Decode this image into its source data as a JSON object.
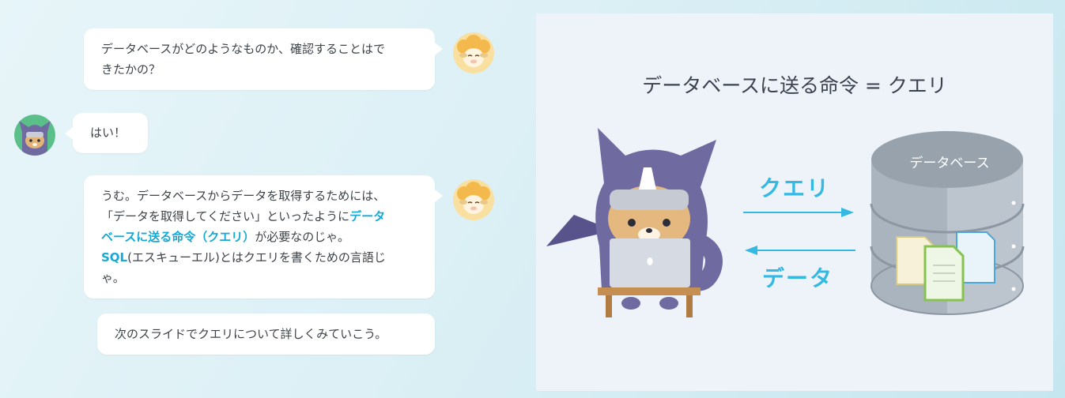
{
  "chat": {
    "msg1": {
      "line1": "データベースがどのようなものか、確認することはで",
      "line2": "きたかの？"
    },
    "msg2": {
      "text": "はい！"
    },
    "msg3": {
      "line1": "うむ。データベースからデータを取得するためには、",
      "line2_pre": "「データを取得してください」といったように",
      "line2_hl": "データ",
      "line3_hl": "ベースに送る命令（クエリ）",
      "line3_post": "が必要なのじゃ。",
      "line4_hl": "SQL",
      "line4_post": "(エスキューエル)とはクエリを書くための言語じ",
      "line5": "ゃ。"
    },
    "msg4": {
      "text": "次のスライドでクエリについて詳しくみていこう。"
    }
  },
  "slide": {
    "title": "データベースに送る命令 = クエリ",
    "query_label": "クエリ",
    "data_label": "データ",
    "db_label": "データベース"
  },
  "colors": {
    "highlight": "#14a9d6",
    "arrow": "#34b9e3",
    "ninja": "#6f6aa0",
    "database": "#9aa5b1"
  },
  "icons": {
    "sheep": "sheep-avatar-icon",
    "ninja": "ninja-avatar-icon"
  }
}
